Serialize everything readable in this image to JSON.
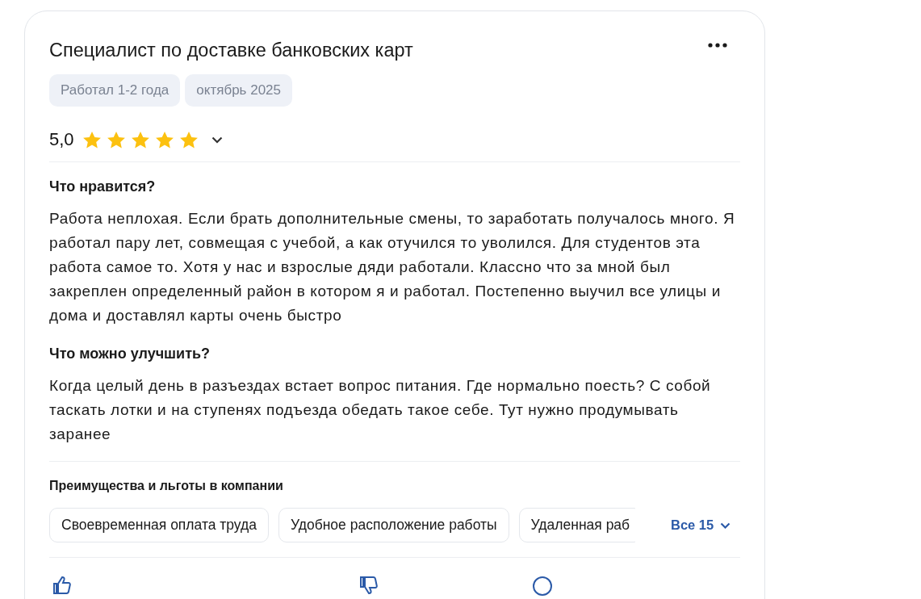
{
  "review": {
    "title": "Специалист по доставке банковских карт",
    "tags": [
      "Работал 1-2 года",
      "октябрь 2025"
    ],
    "rating": {
      "value": "5,0",
      "stars": 5,
      "expanded": false
    },
    "sections": [
      {
        "heading": "Что нравится?",
        "text": "Работа неплохая. Если брать дополнительные смены, то заработать получалось много. Я работал пару лет, совмещая с учебой, а как отучился то уволился. Для студентов эта работа самое то. Хотя у нас и взрослые дяди работали. Классно что за мной был закреплен определенный район в котором я и работал. Постепенно выучил все улицы и дома и доставлял карты очень быстро"
      },
      {
        "heading": "Что можно улучшить?",
        "text": "Когда целый день в разъездах встает вопрос питания. Где нормально поесть? С собой таскать лотки и на ступенях подъезда обедать такое себе. Тут нужно продумывать заранее"
      }
    ],
    "benefits": {
      "heading": "Преимущества и льготы в компании",
      "items": [
        "Своевременная оплата труда",
        "Удобное расположение работы",
        "Удаленная раб"
      ],
      "more": "Все 15",
      "expanded": false
    }
  }
}
